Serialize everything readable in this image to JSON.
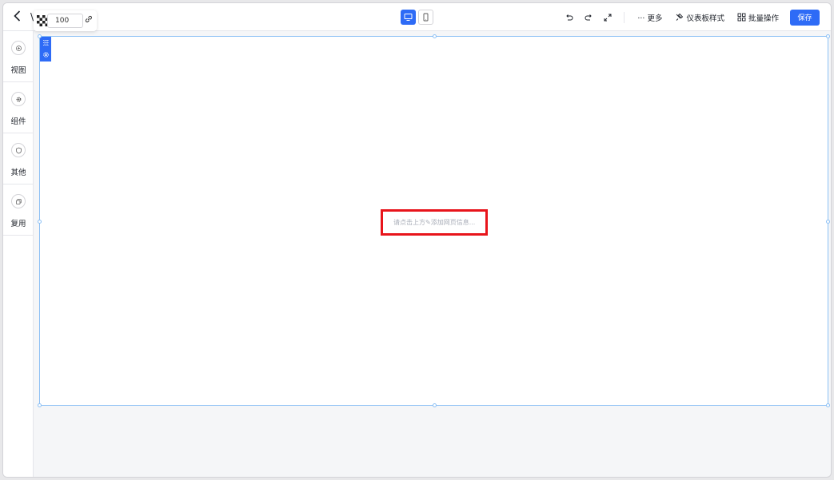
{
  "header": {
    "title_fragment": "\\",
    "opacity_value": "100",
    "device_modes": [
      "desktop",
      "mobile"
    ],
    "active_device": "desktop",
    "more_label": "··· 更多",
    "dashboard_style_label": "仪表板样式",
    "batch_label": "批量操作",
    "save_label": "保存"
  },
  "sidebar": {
    "items": [
      {
        "label": "视图",
        "icon": "plus-circle-icon"
      },
      {
        "label": "组件",
        "icon": "gear-icon"
      },
      {
        "label": "其他",
        "icon": "shield-icon"
      },
      {
        "label": "复用",
        "icon": "copy-icon"
      }
    ]
  },
  "canvas": {
    "placeholder": "请点击上方✎添加网页信息...",
    "highlight_color": "#e8141b",
    "accent_color": "#2e6bf6"
  }
}
